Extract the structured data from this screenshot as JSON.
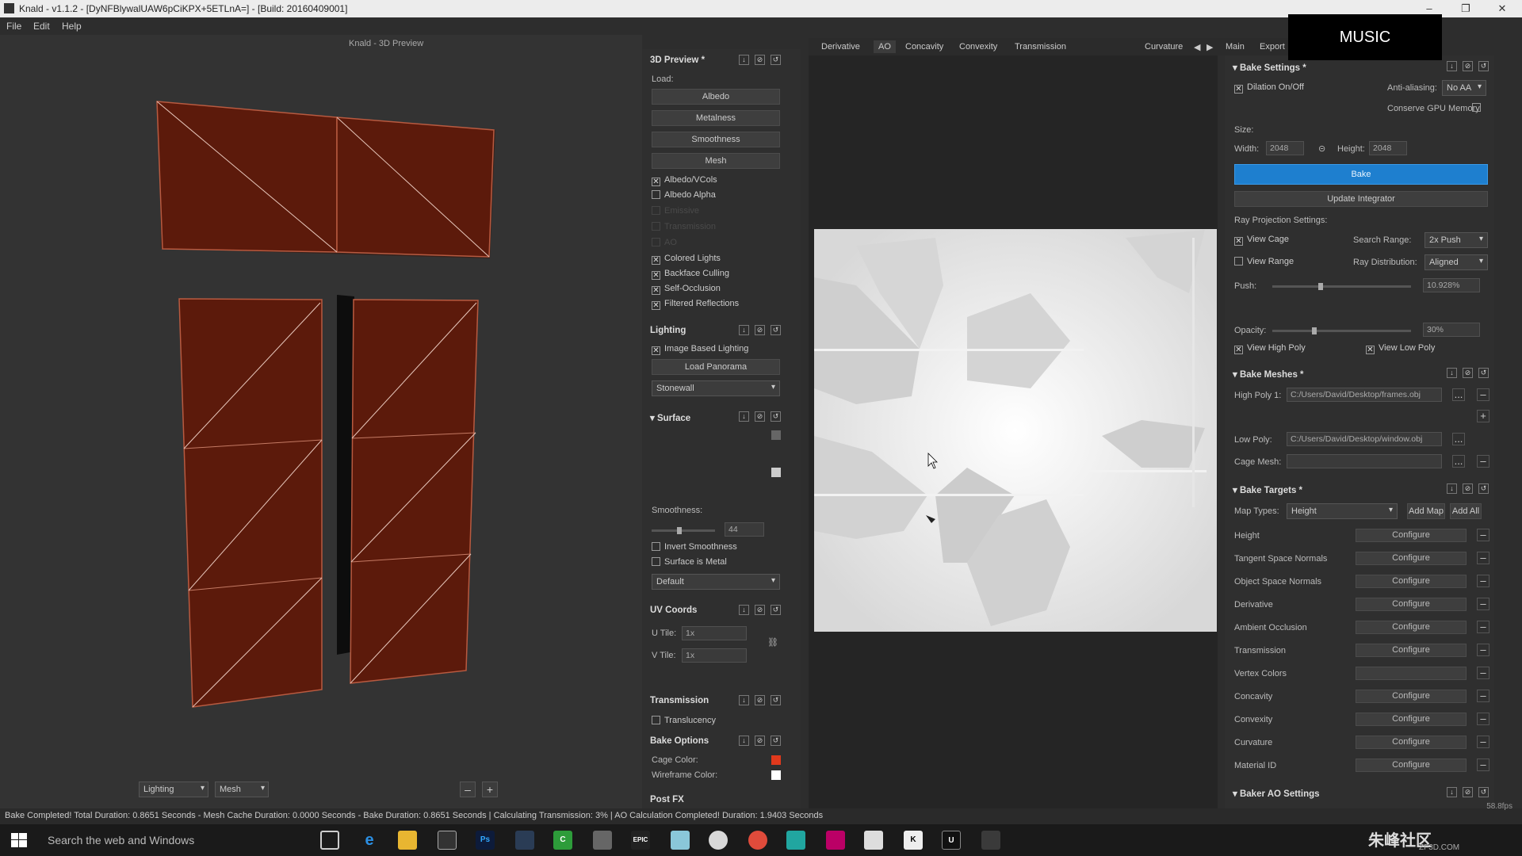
{
  "window": {
    "title": "Knald - v1.1.2 - [DyNFBlywalUAW6pCiKPX+5ETLnA=] - [Build: 20160409001]",
    "min": "–",
    "max": "❐",
    "close": "✕"
  },
  "menu": [
    "File",
    "Edit",
    "Help"
  ],
  "viewport": {
    "title": "Knald - 3D Preview",
    "lighting_select": "Lighting",
    "mesh_select": "Mesh",
    "minus": "–",
    "plus": "+",
    "mesh_color": "#5c1a0b",
    "edge_color": "#b85a40"
  },
  "preview_panel": {
    "title": "3D Preview *",
    "load_label": "Load:",
    "load_buttons": [
      "Albedo",
      "Metalness",
      "Smoothness",
      "Mesh"
    ],
    "options": [
      {
        "label": "Albedo/VCols",
        "checked": true
      },
      {
        "label": "Albedo Alpha",
        "checked": false
      }
    ],
    "dim_options": [
      "Emissive",
      "Transmission",
      "AO"
    ],
    "options2": [
      {
        "label": "Colored Lights",
        "checked": true
      },
      {
        "label": "Backface Culling",
        "checked": true
      },
      {
        "label": "Self-Occlusion",
        "checked": true
      },
      {
        "label": "Filtered Reflections",
        "checked": true
      }
    ],
    "lighting": {
      "title": "Lighting",
      "ibl": "Image Based Lighting",
      "load_panorama": "Load Panorama",
      "panorama": "Stonewall"
    },
    "surface": {
      "title": "Surface",
      "smoothness_label": "Smoothness:",
      "smoothness_value": "44",
      "smoothness": 0.44,
      "invert": "Invert Smoothness",
      "metal": "Surface is Metal",
      "preset": "Default"
    },
    "uv": {
      "title": "UV Coords",
      "u_label": "U Tile:",
      "u_value": "1x",
      "v_label": "V Tile:",
      "v_value": "1x"
    },
    "transmission": {
      "title": "Transmission",
      "translucency": "Translucency"
    },
    "bake_options": {
      "title": "Bake Options",
      "cage_color_label": "Cage Color:",
      "cage_color": "#e0391c",
      "wire_color_label": "Wireframe Color:",
      "wire_color": "#ffffff"
    },
    "post_fx": {
      "title": "Post FX"
    }
  },
  "tabs": [
    "Derivative",
    "AO",
    "Concavity",
    "Convexity",
    "Transmission",
    "Curvature",
    "Main",
    "Export"
  ],
  "active_tab": "AO",
  "bake_settings": {
    "title": "Bake Settings *",
    "dilation": "Dilation On/Off",
    "aa_label": "Anti-aliasing:",
    "aa_value": "No AA",
    "conserve": "Conserve GPU Memory",
    "size_label": "Size:",
    "width_label": "Width:",
    "width": "2048",
    "height_label": "Height:",
    "height": "2048",
    "bake": "Bake",
    "update": "Update Integrator",
    "ray_label": "Ray Projection Settings:",
    "view_cage": "View Cage",
    "search_label": "Search Range:",
    "search_value": "2x Push",
    "view_range": "View Range",
    "dist_label": "Ray Distribution:",
    "dist_value": "Aligned",
    "push_label": "Push:",
    "push_value": "10.928%",
    "push": 0.35,
    "opacity_label": "Opacity:",
    "opacity_value": "30%",
    "opacity": 0.3,
    "view_high": "View High Poly",
    "view_low": "View Low Poly"
  },
  "bake_meshes": {
    "title": "Bake Meshes *",
    "high_label": "High Poly 1:",
    "high_value": "C:/Users/David/Desktop/frames.obj",
    "low_label": "Low Poly:",
    "low_value": "C:/Users/David/Desktop/window.obj",
    "cage_label": "Cage Mesh:",
    "dots": "...",
    "plus": "+",
    "minus": "–"
  },
  "bake_targets": {
    "title": "Bake Targets *",
    "map_types_label": "Map Types:",
    "map_type": "Height",
    "add_map": "Add Map",
    "add_all": "Add All",
    "configure": "Configure",
    "targets": [
      "Height",
      "Tangent Space Normals",
      "Object Space Normals",
      "Derivative",
      "Ambient Occlusion",
      "Transmission",
      "Vertex Colors",
      "Concavity",
      "Convexity",
      "Curvature",
      "Material ID"
    ]
  },
  "baker_ao": {
    "title": "Baker AO Settings"
  },
  "overlay": {
    "music": "MUSIC"
  },
  "status": "Bake Completed! Total Duration: 0.8651 Seconds - Mesh Cache Duration: 0.0000 Seconds - Bake Duration: 0.8651 Seconds | Calculating Transmission: 3% | AO Calculation Completed! Duration: 1.9403 Seconds",
  "fps": "58.8fps",
  "taskbar": {
    "search": "Search the web and Windows",
    "watermark": "朱峰社区",
    "time": "ZF3D.COM"
  }
}
